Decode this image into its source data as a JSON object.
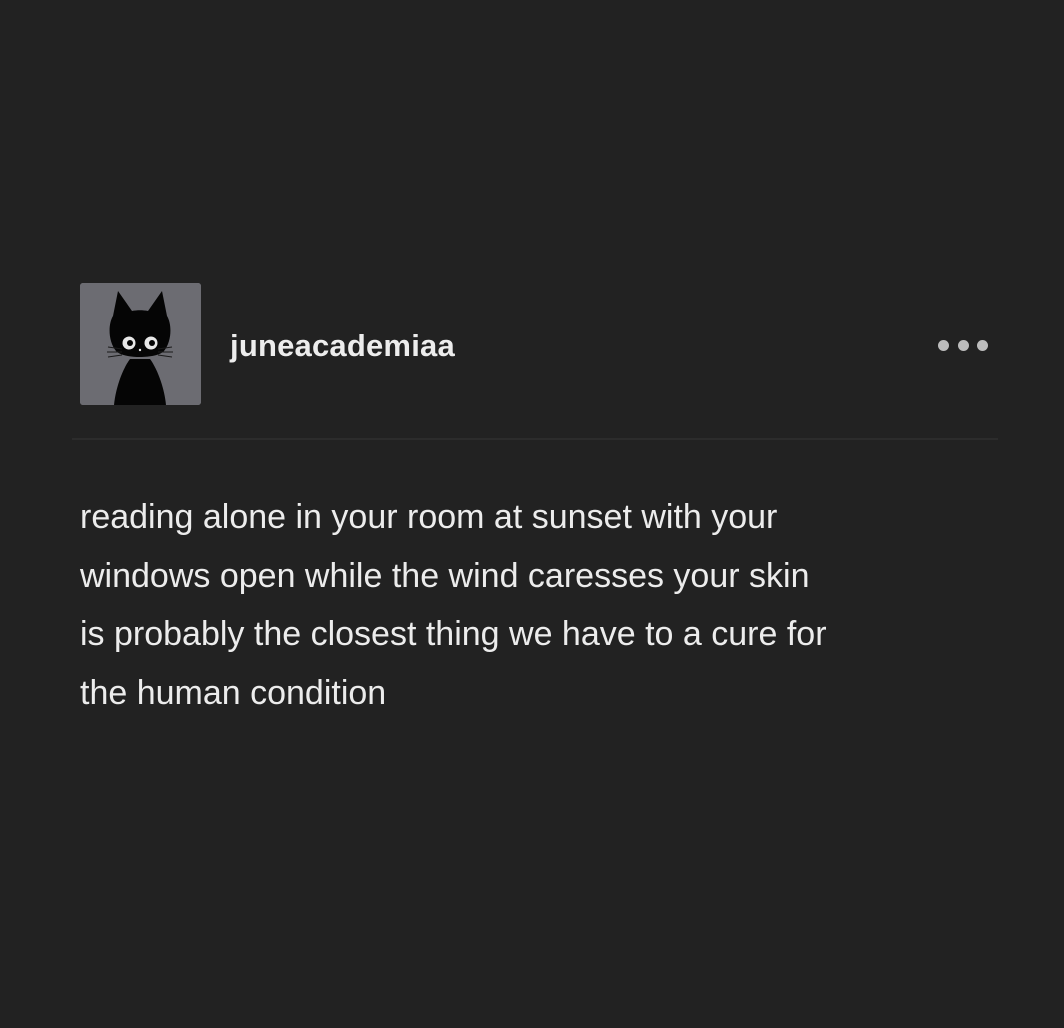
{
  "post": {
    "author": {
      "username": "juneacademiaa",
      "avatar_icon": "black-cat-avatar-icon"
    },
    "menu_icon": "more-options-icon",
    "body_lines": [
      "reading alone in your room at sunset with your",
      "windows open while the wind caresses your skin",
      "is probably the closest thing we have to a cure for",
      "the human condition"
    ]
  },
  "colors": {
    "background": "#222222",
    "text": "#ececec",
    "avatar_background": "#6c6c72",
    "menu_dots": "#bdbdbd"
  }
}
